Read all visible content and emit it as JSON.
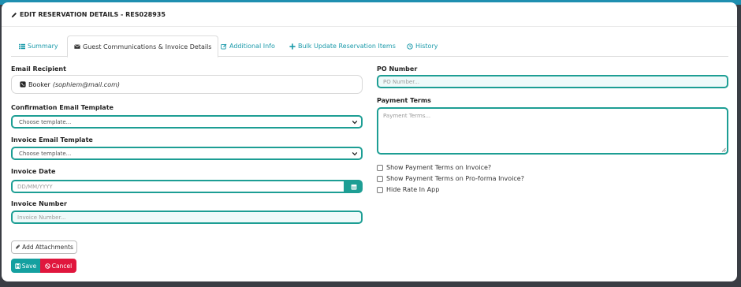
{
  "header": {
    "title": "EDIT RESERVATION DETAILS - RES028935"
  },
  "tabs": [
    {
      "label": "Summary",
      "icon": "list-icon"
    },
    {
      "label": "Guest Communications & Invoice Details",
      "icon": "envelope-icon",
      "active": true
    },
    {
      "label": "Additional Info",
      "icon": "edit-icon"
    },
    {
      "label": "Bulk Update Reservation Items",
      "icon": "plus-icon"
    },
    {
      "label": "History",
      "icon": "clock-icon"
    }
  ],
  "left": {
    "email_recipient": {
      "label": "Email Recipient",
      "name": "Booker",
      "email": "(sophiem@mail.com)"
    },
    "confirmation_template": {
      "label": "Confirmation Email Template",
      "value": "Choose template..."
    },
    "invoice_template": {
      "label": "Invoice Email Template",
      "value": "Choose template..."
    },
    "invoice_date": {
      "label": "Invoice Date",
      "placeholder": "DD/MM/YYYY"
    },
    "invoice_number": {
      "label": "Invoice Number",
      "placeholder": "Invoice Number..."
    }
  },
  "right": {
    "po_number": {
      "label": "PO Number",
      "placeholder": "PO Number..."
    },
    "payment_terms": {
      "label": "Payment Terms",
      "placeholder": "Payment Terms..."
    },
    "checkboxes": [
      {
        "label": "Show Payment Terms on Invoice?",
        "checked": false
      },
      {
        "label": "Show Payment Terms on Pro-forma Invoice?",
        "checked": false
      },
      {
        "label": "Hide Rate In App",
        "checked": false
      }
    ]
  },
  "actions": {
    "add_attachments": "Add Attachments",
    "save": "Save",
    "cancel": "Cancel"
  },
  "colors": {
    "accent": "#1d9e94",
    "link": "#1a9aaa",
    "danger": "#e0163d"
  }
}
